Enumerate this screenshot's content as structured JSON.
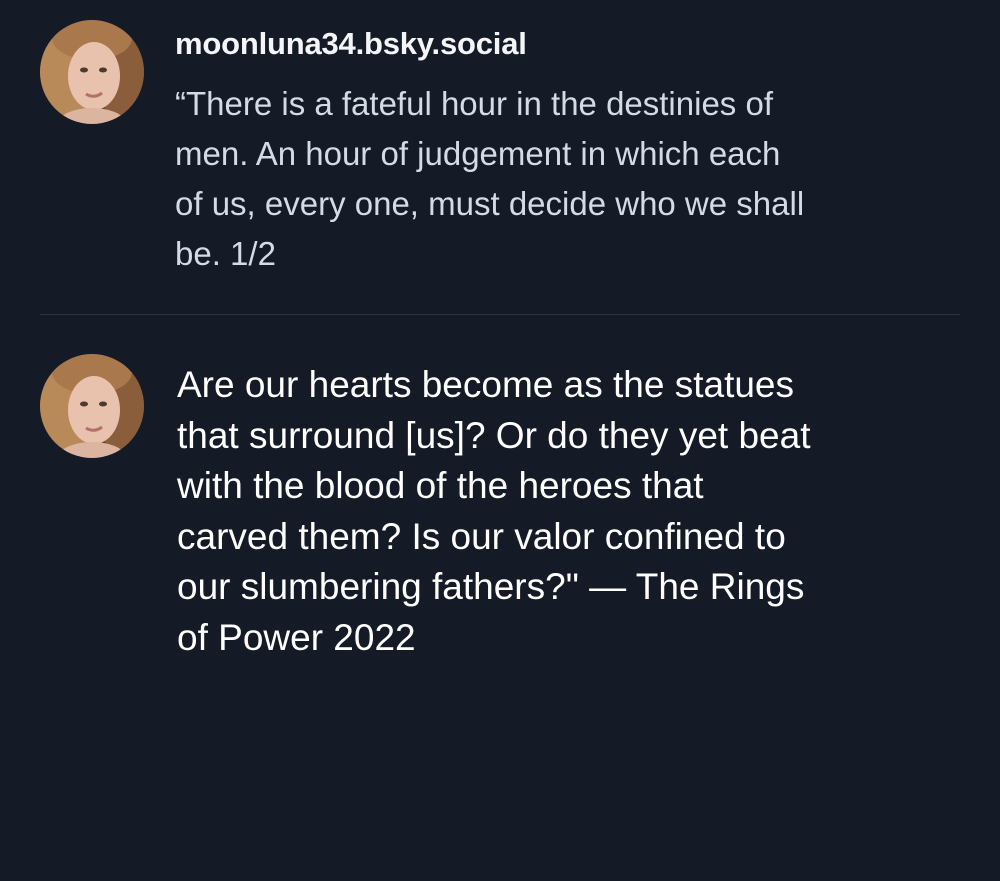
{
  "posts": [
    {
      "handle": "moonluna34.bsky.social",
      "text": "“There is a fateful hour in the destinies of\nmen. An hour of judgement in which each\nof us, every one, must decide who we shall\nbe. 1/2"
    },
    {
      "text": " Are our hearts become as the statues\nthat surround [us]? Or do they yet beat\nwith the blood of the heroes that\ncarved them? Is our valor confined to\nour slumbering fathers?\" — The Rings\nof Power 2022"
    }
  ],
  "colors": {
    "background": "#151b26",
    "divider": "#2c3441",
    "handle": "#f3f5f8",
    "text_primary": "#ffffff",
    "text_secondary": "#d4dbe5"
  }
}
